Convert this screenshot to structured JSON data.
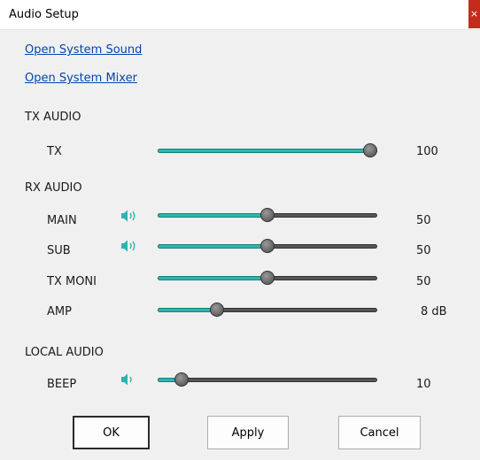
{
  "window": {
    "title": "Audio Setup",
    "close_glyph": "×"
  },
  "links": {
    "system_sound": "Open System Sound",
    "system_mixer": "Open System Mixer"
  },
  "tx_audio": {
    "heading": "TX AUDIO",
    "rows": [
      {
        "label": "TX",
        "value": 100,
        "value_text": "100",
        "speaker": false
      }
    ]
  },
  "rx_audio": {
    "heading": "RX AUDIO",
    "rows": [
      {
        "label": "MAIN",
        "value": 50,
        "value_text": "50",
        "speaker": true,
        "speaker_icon": "speaker-loud-icon"
      },
      {
        "label": "SUB",
        "value": 50,
        "value_text": "50",
        "speaker": true,
        "speaker_icon": "speaker-loud-icon"
      },
      {
        "label": "TX MONI",
        "value": 50,
        "value_text": "50",
        "speaker": false
      },
      {
        "label": "AMP",
        "value": 27,
        "value_text": "8  dB",
        "speaker": false
      }
    ]
  },
  "local_audio": {
    "heading": "LOCAL AUDIO",
    "rows": [
      {
        "label": "BEEP",
        "value": 11,
        "value_text": "10",
        "speaker": true,
        "speaker_icon": "speaker-soft-icon"
      }
    ]
  },
  "buttons": {
    "ok": "OK",
    "apply": "Apply",
    "cancel": "Cancel"
  },
  "colors": {
    "slider_fill": "#2fb3b0",
    "slider_track": "#555555",
    "speaker_icon": "#2fb3b0",
    "link": "#0645ad",
    "close": "#c42b1c"
  }
}
